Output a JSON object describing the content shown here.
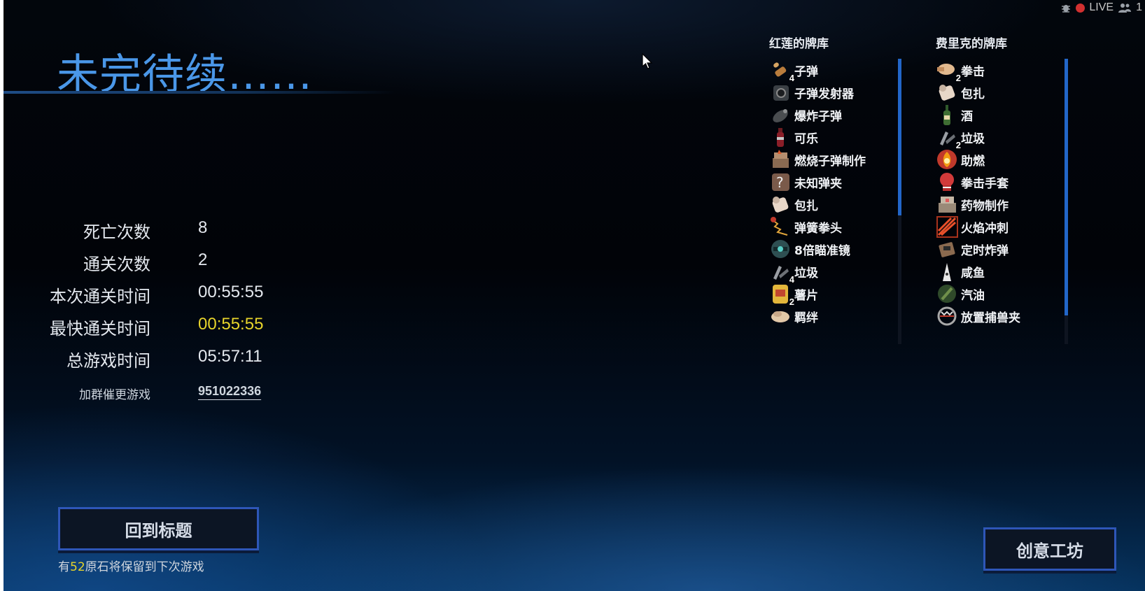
{
  "overlay": {
    "live_label": "LIVE",
    "viewer_count": "1"
  },
  "title": "未完待续……",
  "stats": [
    {
      "label": "死亡次数",
      "value": "8"
    },
    {
      "label": "通关次数",
      "value": "2"
    },
    {
      "label": "本次通关时间",
      "value": "00:55:55"
    },
    {
      "label": "最快通关时间",
      "value": "00:55:55"
    },
    {
      "label": "总游戏时间",
      "value": "05:57:11"
    }
  ],
  "group": {
    "label": "加群催更游戏",
    "value": "951022336"
  },
  "back_button": {
    "label": "回到标题"
  },
  "retain_note": {
    "prefix": "有",
    "amount": "52",
    "suffix": "原石将保留到下次游戏"
  },
  "workshop_button": {
    "label": "创意工坊"
  },
  "decks": [
    {
      "title": "红莲的牌库",
      "scroll_fraction": 0.55,
      "items": [
        {
          "label": "子弹",
          "count": "4",
          "icon": "bullet-icon"
        },
        {
          "label": "子弹发射器",
          "count": "",
          "icon": "bullet-launcher-icon"
        },
        {
          "label": "爆炸子弹",
          "count": "",
          "icon": "explosive-bullet-icon"
        },
        {
          "label": "可乐",
          "count": "",
          "icon": "cola-bottle-icon"
        },
        {
          "label": "燃烧子弹制作",
          "count": "",
          "icon": "incendiary-craft-icon"
        },
        {
          "label": "未知弹夹",
          "count": "",
          "icon": "unknown-magazine-icon"
        },
        {
          "label": "包扎",
          "count": "",
          "icon": "bandage-icon"
        },
        {
          "label": "弹簧拳头",
          "count": "",
          "icon": "spring-fist-icon"
        },
        {
          "label": "8倍瞄准镜",
          "count": "",
          "icon": "scope-icon"
        },
        {
          "label": "垃圾",
          "count": "4",
          "icon": "trash-icon"
        },
        {
          "label": "薯片",
          "count": "2",
          "icon": "chips-icon"
        },
        {
          "label": "羁绊",
          "count": "",
          "icon": "handshake-icon"
        }
      ]
    },
    {
      "title": "费里克的牌库",
      "scroll_fraction": 0.9,
      "items": [
        {
          "label": "拳击",
          "count": "2",
          "icon": "punch-icon"
        },
        {
          "label": "包扎",
          "count": "",
          "icon": "bandage-icon"
        },
        {
          "label": "酒",
          "count": "",
          "icon": "wine-bottle-icon"
        },
        {
          "label": "垃圾",
          "count": "2",
          "icon": "trash-icon"
        },
        {
          "label": "助燃",
          "count": "",
          "icon": "fire-boost-icon"
        },
        {
          "label": "拳击手套",
          "count": "",
          "icon": "boxing-glove-icon"
        },
        {
          "label": "药物制作",
          "count": "",
          "icon": "drug-craft-icon"
        },
        {
          "label": "火焰冲刺",
          "count": "",
          "icon": "flame-dash-icon"
        },
        {
          "label": "定时炸弹",
          "count": "",
          "icon": "time-bomb-icon"
        },
        {
          "label": "咸鱼",
          "count": "",
          "icon": "salted-fish-icon"
        },
        {
          "label": "汽油",
          "count": "",
          "icon": "gasoline-icon"
        },
        {
          "label": "放置捕兽夹",
          "count": "",
          "icon": "bear-trap-icon"
        }
      ]
    }
  ],
  "colors": {
    "accent_blue": "#4a97e8",
    "gold": "#e7d42b",
    "button_border": "#2e56b8",
    "scroll_thumb": "#2266c8"
  }
}
